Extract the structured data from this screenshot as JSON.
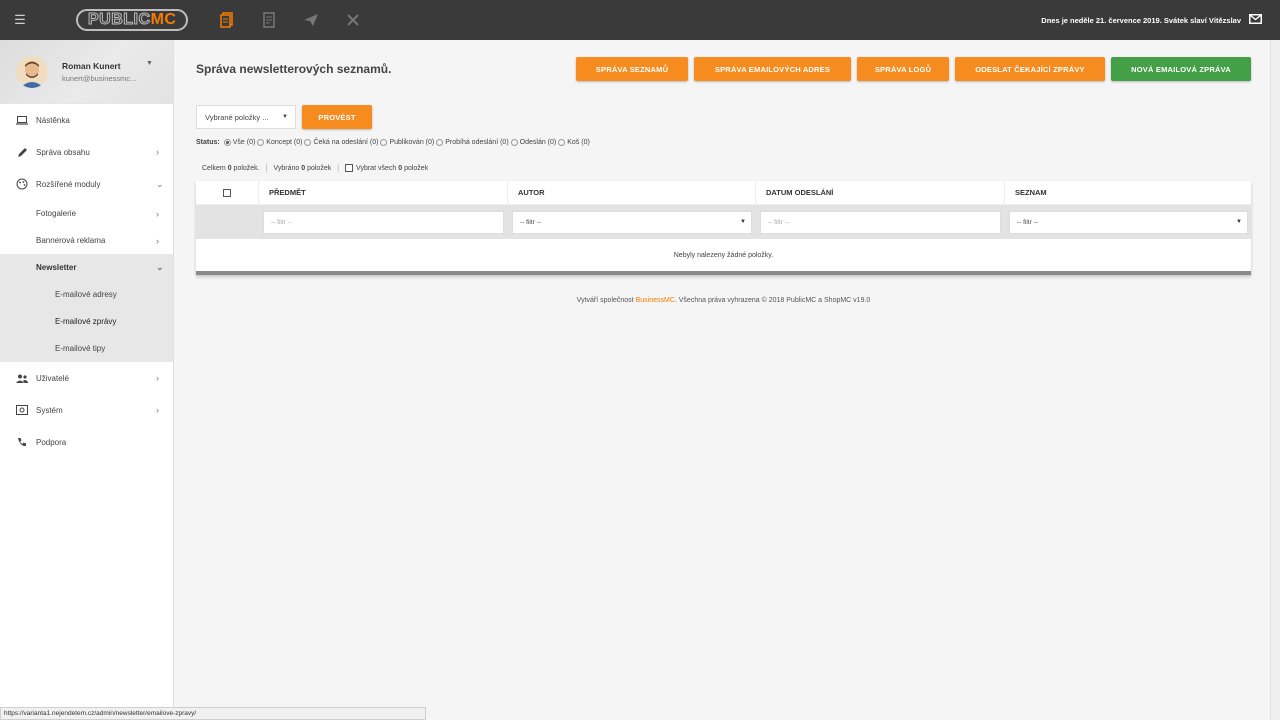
{
  "topbar": {
    "menu_icon": "hamburger-icon",
    "logo_public": "PUBLIC",
    "logo_mc": "MC",
    "icons": [
      "documents-icon",
      "newspaper-icon",
      "paper-plane-icon",
      "tools-icon"
    ],
    "date_text": "Dnes je neděle 21. července 2019. Svátek slaví Vítězslav",
    "mail_icon": "envelope-icon"
  },
  "user": {
    "name": "Roman Kunert",
    "email": "kunert@businessmc..."
  },
  "sidebar": {
    "items": [
      {
        "label": "Nástěnka",
        "icon": "laptop-icon"
      },
      {
        "label": "Správa obsahu",
        "icon": "pencil-icon"
      },
      {
        "label": "Rozšířené moduly",
        "icon": "palette-icon"
      },
      {
        "label": "Uživatelé",
        "icon": "users-icon"
      },
      {
        "label": "Systém",
        "icon": "system-icon"
      },
      {
        "label": "Podpora",
        "icon": "phone-icon"
      }
    ],
    "modules_sub": [
      {
        "label": "Fotogalerie"
      },
      {
        "label": "Bannerová reklama"
      },
      {
        "label": "Newsletter"
      }
    ],
    "newsletter_sub": [
      {
        "label": "E-mailové adresy"
      },
      {
        "label": "E-mailové zprávy"
      },
      {
        "label": "E-mailové tipy"
      }
    ]
  },
  "main": {
    "title": "Správa newsletterových seznamů.",
    "buttons": {
      "lists": "SPRÁVA SEZNAMŮ",
      "addresses": "SPRÁVA EMAILOVÝCH ADRES",
      "logos": "SPRÁVA LOGŮ",
      "send_pending": "ODESLAT ČEKAJÍCÍ ZPRÁVY",
      "new_message": "NOVÁ EMAILOVÁ ZPRÁVA"
    },
    "bulk_select": "Vybrané položky ...",
    "run_label": "PROVÉST",
    "status_label": "Status:",
    "statuses": [
      "Vše (0)",
      "Koncept (0)",
      "Čeká na odeslání (0)",
      "Publikován (0)",
      "Probíhá odeslání (0)",
      "Odeslán (0)",
      "Koš (0)"
    ],
    "counts": {
      "total_prefix": "Celkem",
      "total_value": "0",
      "total_suffix": "položek.",
      "selected_prefix": "Vybráno",
      "selected_value": "0",
      "selected_suffix": "položek",
      "select_all_prefix": "Vybrat všech",
      "select_all_value": "0",
      "select_all_suffix": "položek"
    },
    "table": {
      "headers": [
        "PŘEDMĚT",
        "AUTOR",
        "DATUM ODESLÁNÍ",
        "SEZNAM"
      ],
      "filter_placeholder": "-- filtr --",
      "filter_select": "-- filtr --",
      "empty_message": "Nebyly nalezeny žádné položky."
    },
    "footer": {
      "prefix": "Vytváří společnost",
      "brand": "BusinessMC",
      "suffix": ". Všechna práva vyhrazena © 2018 PublicMC a ShopMC v19.0"
    }
  },
  "statusbar_url": "https://varianta1.nejendetem.cz/admin/newsletter/emailove-zpravy/",
  "colors": {
    "accent_orange": "#f68b1f",
    "accent_green": "#43a047",
    "topbar": "#3a3a3a"
  }
}
